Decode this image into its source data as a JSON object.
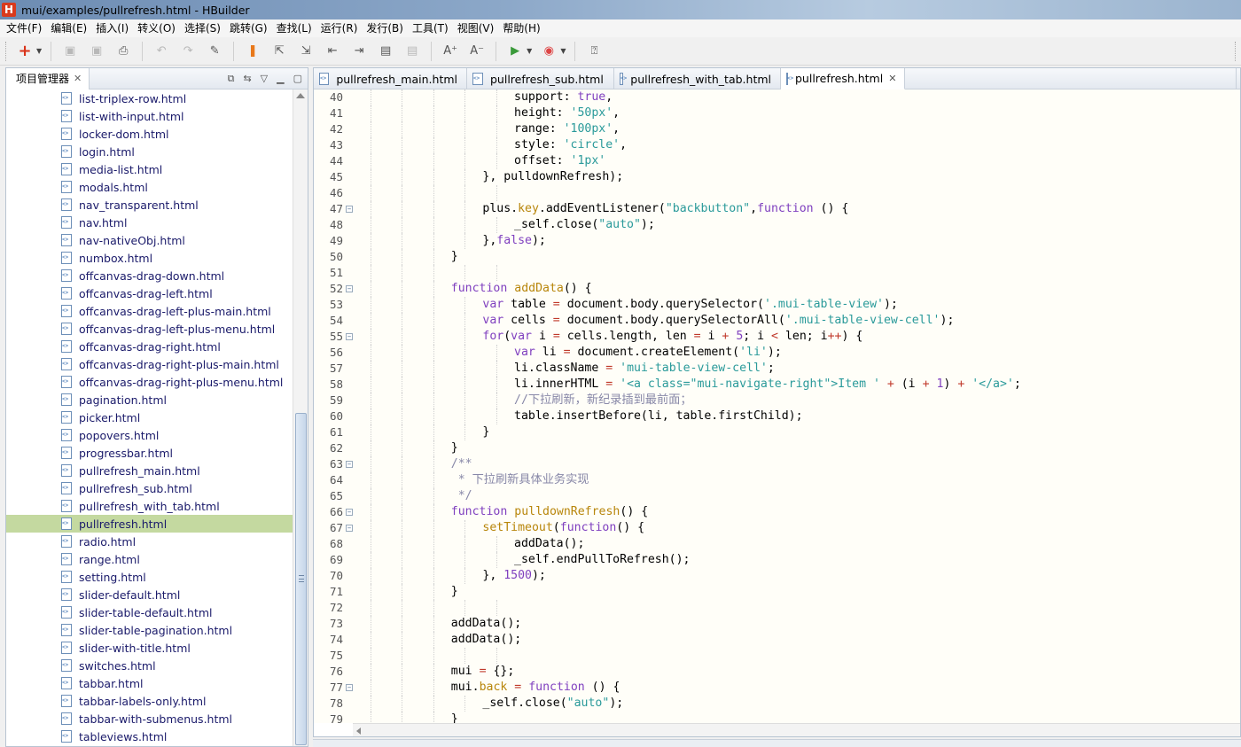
{
  "window": {
    "title": "mui/examples/pullrefresh.html  -  HBuilder",
    "icon_letter": "H"
  },
  "menu": [
    "文件(F)",
    "编辑(E)",
    "插入(I)",
    "转义(O)",
    "选择(S)",
    "跳转(G)",
    "查找(L)",
    "运行(R)",
    "发行(B)",
    "工具(T)",
    "视图(V)",
    "帮助(H)"
  ],
  "project_panel": {
    "tab_label": "项目管理器",
    "files": [
      "list-triplex-row.html",
      "list-with-input.html",
      "locker-dom.html",
      "login.html",
      "media-list.html",
      "modals.html",
      "nav_transparent.html",
      "nav.html",
      "nav-nativeObj.html",
      "numbox.html",
      "offcanvas-drag-down.html",
      "offcanvas-drag-left.html",
      "offcanvas-drag-left-plus-main.html",
      "offcanvas-drag-left-plus-menu.html",
      "offcanvas-drag-right.html",
      "offcanvas-drag-right-plus-main.html",
      "offcanvas-drag-right-plus-menu.html",
      "pagination.html",
      "picker.html",
      "popovers.html",
      "progressbar.html",
      "pullrefresh_main.html",
      "pullrefresh_sub.html",
      "pullrefresh_with_tab.html",
      "pullrefresh.html",
      "radio.html",
      "range.html",
      "setting.html",
      "slider-default.html",
      "slider-table-default.html",
      "slider-table-pagination.html",
      "slider-with-title.html",
      "switches.html",
      "tabbar.html",
      "tabbar-labels-only.html",
      "tabbar-with-submenus.html",
      "tableviews.html"
    ],
    "selected_file": "pullrefresh.html"
  },
  "editor": {
    "tabs": [
      {
        "label": "pullrefresh_main.html"
      },
      {
        "label": "pullrefresh_sub.html"
      },
      {
        "label": "pullrefresh_with_tab.html"
      },
      {
        "label": "pullrefresh.html",
        "active": true
      }
    ],
    "lines": [
      {
        "n": "40",
        "fold": false,
        "i": 5,
        "t": [
          [
            "support",
            ""
          ],
          [
            ": ",
            ""
          ],
          [
            "true",
            "kw"
          ],
          [
            ",",
            ""
          ]
        ]
      },
      {
        "n": "41",
        "fold": false,
        "i": 5,
        "t": [
          [
            "height: ",
            ""
          ],
          [
            "'50px'",
            "str"
          ],
          [
            ",",
            ""
          ]
        ]
      },
      {
        "n": "42",
        "fold": false,
        "i": 5,
        "t": [
          [
            "range: ",
            ""
          ],
          [
            "'100px'",
            "str"
          ],
          [
            ",",
            ""
          ]
        ]
      },
      {
        "n": "43",
        "fold": false,
        "i": 5,
        "t": [
          [
            "style: ",
            ""
          ],
          [
            "'circle'",
            "str"
          ],
          [
            ",",
            ""
          ]
        ]
      },
      {
        "n": "44",
        "fold": false,
        "i": 5,
        "t": [
          [
            "offset: ",
            ""
          ],
          [
            "'1px'",
            "str"
          ]
        ]
      },
      {
        "n": "45",
        "fold": false,
        "i": 4,
        "t": [
          [
            "}, pulldownRefresh);",
            ""
          ]
        ]
      },
      {
        "n": "46",
        "fold": false,
        "i": 0,
        "t": []
      },
      {
        "n": "47",
        "fold": true,
        "i": 4,
        "t": [
          [
            "plus.",
            ""
          ],
          [
            "key",
            "prop"
          ],
          [
            ".addEventListener(",
            ""
          ],
          [
            "\"backbutton\"",
            "str"
          ],
          [
            ",",
            ""
          ],
          [
            "function",
            "kw"
          ],
          [
            " () {",
            ""
          ]
        ]
      },
      {
        "n": "48",
        "fold": false,
        "i": 5,
        "t": [
          [
            "_self.close(",
            ""
          ],
          [
            "\"auto\"",
            "str"
          ],
          [
            ");",
            ""
          ]
        ]
      },
      {
        "n": "49",
        "fold": false,
        "i": 4,
        "t": [
          [
            "},",
            ""
          ],
          [
            "false",
            "kw"
          ],
          [
            ");",
            ""
          ]
        ]
      },
      {
        "n": "50",
        "fold": false,
        "i": 3,
        "t": [
          [
            "}",
            ""
          ]
        ]
      },
      {
        "n": "51",
        "fold": false,
        "i": 0,
        "t": []
      },
      {
        "n": "52",
        "fold": true,
        "i": 3,
        "t": [
          [
            "function",
            "kw"
          ],
          [
            " ",
            ""
          ],
          [
            "addData",
            "fn"
          ],
          [
            "() {",
            ""
          ]
        ]
      },
      {
        "n": "53",
        "fold": false,
        "i": 4,
        "t": [
          [
            "var",
            "kw"
          ],
          [
            " table ",
            ""
          ],
          [
            "=",
            "op"
          ],
          [
            " document.body.querySelector(",
            ""
          ],
          [
            "'.mui-table-view'",
            "str"
          ],
          [
            ");",
            ""
          ]
        ]
      },
      {
        "n": "54",
        "fold": false,
        "i": 4,
        "t": [
          [
            "var",
            "kw"
          ],
          [
            " cells ",
            ""
          ],
          [
            "=",
            "op"
          ],
          [
            " document.body.querySelectorAll(",
            ""
          ],
          [
            "'.mui-table-view-cell'",
            "str"
          ],
          [
            ");",
            ""
          ]
        ]
      },
      {
        "n": "55",
        "fold": true,
        "i": 4,
        "t": [
          [
            "for",
            "kw"
          ],
          [
            "(",
            ""
          ],
          [
            "var",
            "kw"
          ],
          [
            " i ",
            ""
          ],
          [
            "=",
            "op"
          ],
          [
            " cells.length, len ",
            ""
          ],
          [
            "=",
            "op"
          ],
          [
            " i ",
            ""
          ],
          [
            "+",
            "op"
          ],
          [
            " ",
            ""
          ],
          [
            "5",
            "num"
          ],
          [
            "; i ",
            ""
          ],
          [
            "<",
            "op"
          ],
          [
            " len; i",
            ""
          ],
          [
            "++",
            "op"
          ],
          [
            ") {",
            ""
          ]
        ]
      },
      {
        "n": "56",
        "fold": false,
        "i": 5,
        "t": [
          [
            "var",
            "kw"
          ],
          [
            " li ",
            ""
          ],
          [
            "=",
            "op"
          ],
          [
            " document.createElement(",
            ""
          ],
          [
            "'li'",
            "str"
          ],
          [
            ");",
            ""
          ]
        ]
      },
      {
        "n": "57",
        "fold": false,
        "i": 5,
        "t": [
          [
            "li.className ",
            ""
          ],
          [
            "=",
            "op"
          ],
          [
            " ",
            ""
          ],
          [
            "'mui-table-view-cell'",
            "str"
          ],
          [
            ";",
            ""
          ]
        ]
      },
      {
        "n": "58",
        "fold": false,
        "i": 5,
        "t": [
          [
            "li.innerHTML ",
            ""
          ],
          [
            "=",
            "op"
          ],
          [
            " ",
            ""
          ],
          [
            "'<a class=\"mui-navigate-right\">Item '",
            "str"
          ],
          [
            " ",
            ""
          ],
          [
            "+",
            "op"
          ],
          [
            " (i ",
            ""
          ],
          [
            "+",
            "op"
          ],
          [
            " ",
            ""
          ],
          [
            "1",
            "num"
          ],
          [
            ") ",
            ""
          ],
          [
            "+",
            "op"
          ],
          [
            " ",
            ""
          ],
          [
            "'</a>'",
            "str"
          ],
          [
            ";",
            ""
          ]
        ]
      },
      {
        "n": "59",
        "fold": false,
        "i": 5,
        "t": [
          [
            "//下拉刷新，新纪录插到最前面；",
            "cmt"
          ]
        ]
      },
      {
        "n": "60",
        "fold": false,
        "i": 5,
        "t": [
          [
            "table.insertBefore(li, table.firstChild);",
            ""
          ]
        ]
      },
      {
        "n": "61",
        "fold": false,
        "i": 4,
        "t": [
          [
            "}",
            ""
          ]
        ]
      },
      {
        "n": "62",
        "fold": false,
        "i": 3,
        "t": [
          [
            "}",
            ""
          ]
        ]
      },
      {
        "n": "63",
        "fold": true,
        "i": 3,
        "t": [
          [
            "/**",
            "cmt"
          ]
        ]
      },
      {
        "n": "64",
        "fold": false,
        "i": 3,
        "t": [
          [
            " * 下拉刷新具体业务实现",
            "cmt"
          ]
        ]
      },
      {
        "n": "65",
        "fold": false,
        "i": 3,
        "t": [
          [
            " */",
            "cmt"
          ]
        ]
      },
      {
        "n": "66",
        "fold": true,
        "i": 3,
        "t": [
          [
            "function",
            "kw"
          ],
          [
            " ",
            ""
          ],
          [
            "pulldownRefresh",
            "fn"
          ],
          [
            "() {",
            ""
          ]
        ]
      },
      {
        "n": "67",
        "fold": true,
        "i": 4,
        "t": [
          [
            "setTimeout",
            "fn"
          ],
          [
            "(",
            ""
          ],
          [
            "function",
            "kw"
          ],
          [
            "() {",
            ""
          ]
        ]
      },
      {
        "n": "68",
        "fold": false,
        "i": 5,
        "t": [
          [
            "addData();",
            ""
          ]
        ]
      },
      {
        "n": "69",
        "fold": false,
        "i": 5,
        "t": [
          [
            "_self.endPullToRefresh();",
            ""
          ]
        ]
      },
      {
        "n": "70",
        "fold": false,
        "i": 4,
        "t": [
          [
            "}, ",
            ""
          ],
          [
            "1500",
            "num"
          ],
          [
            ");",
            ""
          ]
        ]
      },
      {
        "n": "71",
        "fold": false,
        "i": 3,
        "t": [
          [
            "}",
            ""
          ]
        ]
      },
      {
        "n": "72",
        "fold": false,
        "i": 0,
        "t": []
      },
      {
        "n": "73",
        "fold": false,
        "i": 3,
        "t": [
          [
            "addData();",
            ""
          ]
        ]
      },
      {
        "n": "74",
        "fold": false,
        "i": 3,
        "t": [
          [
            "addData();",
            ""
          ]
        ]
      },
      {
        "n": "75",
        "fold": false,
        "i": 0,
        "t": []
      },
      {
        "n": "76",
        "fold": false,
        "i": 3,
        "t": [
          [
            "mui ",
            ""
          ],
          [
            "=",
            "op"
          ],
          [
            " {};",
            ""
          ]
        ]
      },
      {
        "n": "77",
        "fold": true,
        "i": 3,
        "t": [
          [
            "mui.",
            ""
          ],
          [
            "back",
            "prop"
          ],
          [
            " ",
            ""
          ],
          [
            "=",
            "op"
          ],
          [
            " ",
            ""
          ],
          [
            "function",
            "kw"
          ],
          [
            " () {",
            ""
          ]
        ]
      },
      {
        "n": "78",
        "fold": false,
        "i": 4,
        "t": [
          [
            "_self.close(",
            ""
          ],
          [
            "\"auto\"",
            "str"
          ],
          [
            ");",
            ""
          ]
        ]
      },
      {
        "n": "79",
        "fold": false,
        "i": 3,
        "t": [
          [
            "}",
            ""
          ]
        ]
      }
    ]
  }
}
